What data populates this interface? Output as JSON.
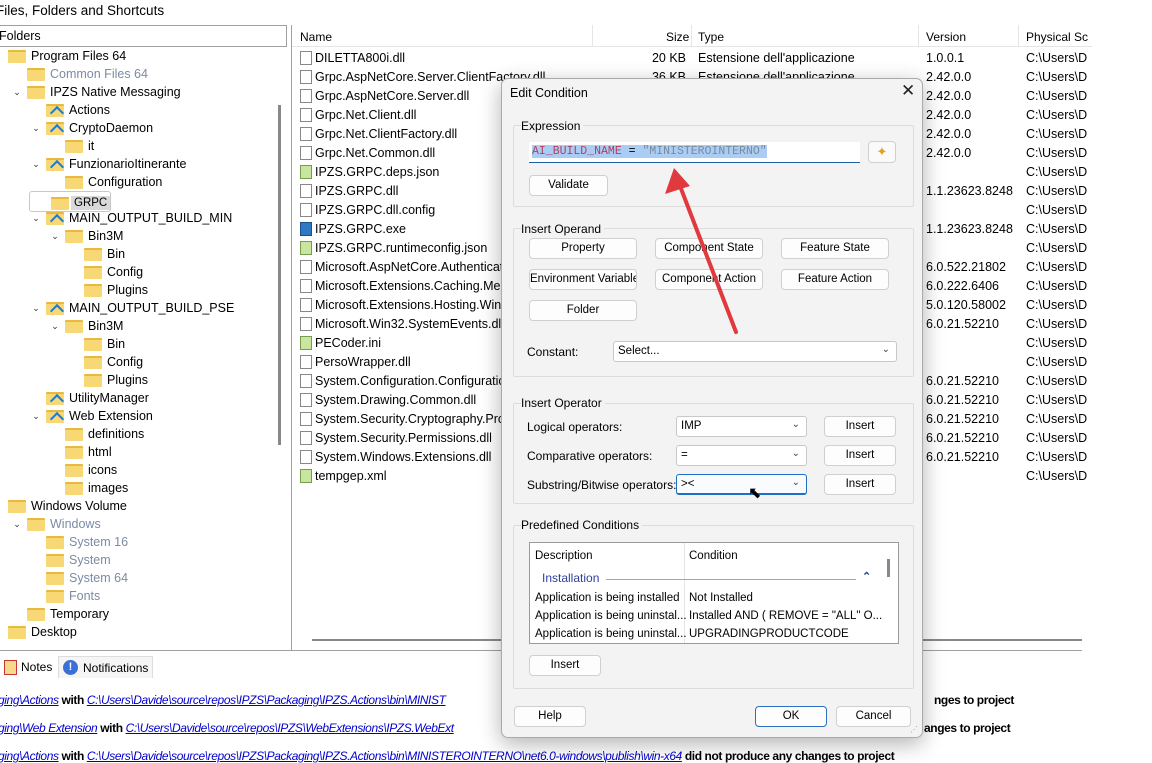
{
  "panel_title": "Files, Folders and Shortcuts",
  "tree_header": "Folders",
  "tree": [
    {
      "label": "Program Files 64",
      "level": 0,
      "chevron": true,
      "type": "folder"
    },
    {
      "label": "Common Files 64",
      "level": 1,
      "chevron": false,
      "type": "folder",
      "grey": true
    },
    {
      "label": "IPZS Native Messaging",
      "level": 1,
      "chevron": true,
      "type": "folder"
    },
    {
      "label": "Actions",
      "level": 2,
      "chevron": false,
      "type": "special"
    },
    {
      "label": "CryptoDaemon",
      "level": 2,
      "chevron": true,
      "type": "special"
    },
    {
      "label": "it",
      "level": 3,
      "chevron": false,
      "type": "folder"
    },
    {
      "label": "FunzionarioItinerante",
      "level": 2,
      "chevron": true,
      "type": "special"
    },
    {
      "label": "Configuration",
      "level": 3,
      "chevron": false,
      "type": "folder"
    },
    {
      "label": "GRPC",
      "level": 2,
      "chevron": false,
      "type": "folder",
      "selected": true
    },
    {
      "label": "MAIN_OUTPUT_BUILD_MIN",
      "level": 2,
      "chevron": true,
      "type": "special"
    },
    {
      "label": "Bin3M",
      "level": 3,
      "chevron": true,
      "type": "folder"
    },
    {
      "label": "Bin",
      "level": 4,
      "chevron": false,
      "type": "folder"
    },
    {
      "label": "Config",
      "level": 4,
      "chevron": false,
      "type": "folder"
    },
    {
      "label": "Plugins",
      "level": 4,
      "chevron": false,
      "type": "folder"
    },
    {
      "label": "MAIN_OUTPUT_BUILD_PSE",
      "level": 2,
      "chevron": true,
      "type": "special"
    },
    {
      "label": "Bin3M",
      "level": 3,
      "chevron": true,
      "type": "folder"
    },
    {
      "label": "Bin",
      "level": 4,
      "chevron": false,
      "type": "folder"
    },
    {
      "label": "Config",
      "level": 4,
      "chevron": false,
      "type": "folder"
    },
    {
      "label": "Plugins",
      "level": 4,
      "chevron": false,
      "type": "folder"
    },
    {
      "label": "UtilityManager",
      "level": 2,
      "chevron": false,
      "type": "special"
    },
    {
      "label": "Web Extension",
      "level": 2,
      "chevron": true,
      "type": "special"
    },
    {
      "label": "definitions",
      "level": 3,
      "chevron": false,
      "type": "folder"
    },
    {
      "label": "html",
      "level": 3,
      "chevron": false,
      "type": "folder"
    },
    {
      "label": "icons",
      "level": 3,
      "chevron": false,
      "type": "folder"
    },
    {
      "label": "images",
      "level": 3,
      "chevron": false,
      "type": "folder"
    },
    {
      "label": "Windows Volume",
      "level": 0,
      "chevron": true,
      "type": "folder"
    },
    {
      "label": "Windows",
      "level": 1,
      "chevron": true,
      "type": "folder",
      "grey": true
    },
    {
      "label": "System 16",
      "level": 2,
      "chevron": false,
      "type": "folder",
      "grey": true
    },
    {
      "label": "System",
      "level": 2,
      "chevron": false,
      "type": "folder",
      "grey": true
    },
    {
      "label": "System 64",
      "level": 2,
      "chevron": false,
      "type": "folder",
      "grey": true
    },
    {
      "label": "Fonts",
      "level": 2,
      "chevron": false,
      "type": "folder",
      "grey": true
    },
    {
      "label": "Temporary",
      "level": 1,
      "chevron": false,
      "type": "folder"
    },
    {
      "label": "Desktop",
      "level": 0,
      "chevron": false,
      "type": "folder"
    }
  ],
  "list_columns": {
    "name": "Name",
    "size": "Size",
    "type": "Type",
    "version": "Version",
    "physical": "Physical Sc"
  },
  "files": [
    {
      "name": "DILETTA800i.dll",
      "icon": "dll",
      "size": "20 KB",
      "type": "Estensione dell'applicazione",
      "version": "1.0.0.1",
      "physical": "C:\\Users\\D"
    },
    {
      "name": "Grpc.AspNetCore.Server.ClientFactory.dll",
      "icon": "dll",
      "size": "36 KB",
      "type": "Estensione dell'applicazione",
      "version": "2.42.0.0",
      "physical": "C:\\Users\\D"
    },
    {
      "name": "Grpc.AspNetCore.Server.dll",
      "icon": "dll",
      "size": "",
      "type": "",
      "version": "2.42.0.0",
      "physical": "C:\\Users\\D"
    },
    {
      "name": "Grpc.Net.Client.dll",
      "icon": "dll",
      "size": "",
      "type": "",
      "version": "2.42.0.0",
      "physical": "C:\\Users\\D"
    },
    {
      "name": "Grpc.Net.ClientFactory.dll",
      "icon": "dll",
      "size": "",
      "type": "",
      "version": "2.42.0.0",
      "physical": "C:\\Users\\D"
    },
    {
      "name": "Grpc.Net.Common.dll",
      "icon": "dll",
      "size": "",
      "type": "",
      "version": "2.42.0.0",
      "physical": "C:\\Users\\D"
    },
    {
      "name": "IPZS.GRPC.deps.json",
      "icon": "json",
      "size": "",
      "type": "",
      "version": "",
      "physical": "C:\\Users\\D"
    },
    {
      "name": "IPZS.GRPC.dll",
      "icon": "dll",
      "size": "",
      "type": "",
      "version": "1.1.23623.8248",
      "physical": "C:\\Users\\D"
    },
    {
      "name": "IPZS.GRPC.dll.config",
      "icon": "config",
      "size": "",
      "type": "",
      "version": "",
      "physical": "C:\\Users\\D"
    },
    {
      "name": "IPZS.GRPC.exe",
      "icon": "exe",
      "size": "",
      "type": "",
      "version": "1.1.23623.8248",
      "physical": "C:\\Users\\D"
    },
    {
      "name": "IPZS.GRPC.runtimeconfig.json",
      "icon": "json",
      "size": "",
      "type": "",
      "version": "",
      "physical": "C:\\Users\\D"
    },
    {
      "name": "Microsoft.AspNetCore.Authenticati",
      "icon": "dll",
      "size": "",
      "type": "",
      "version": "6.0.522.21802",
      "physical": "C:\\Users\\D"
    },
    {
      "name": "Microsoft.Extensions.Caching.Mem",
      "icon": "dll",
      "size": "",
      "type": "",
      "version": "6.0.222.6406",
      "physical": "C:\\Users\\D"
    },
    {
      "name": "Microsoft.Extensions.Hosting.Wind",
      "icon": "dll",
      "size": "",
      "type": "",
      "version": "5.0.120.58002",
      "physical": "C:\\Users\\D"
    },
    {
      "name": "Microsoft.Win32.SystemEvents.dll",
      "icon": "dll",
      "size": "",
      "type": "",
      "version": "6.0.21.52210",
      "physical": "C:\\Users\\D"
    },
    {
      "name": "PECoder.ini",
      "icon": "ini",
      "size": "",
      "type": "",
      "version": "",
      "physical": "C:\\Users\\D"
    },
    {
      "name": "PersoWrapper.dll",
      "icon": "dll",
      "size": "",
      "type": "",
      "version": "",
      "physical": "C:\\Users\\D"
    },
    {
      "name": "System.Configuration.Configuratio",
      "icon": "dll",
      "size": "",
      "type": "",
      "version": "6.0.21.52210",
      "physical": "C:\\Users\\D"
    },
    {
      "name": "System.Drawing.Common.dll",
      "icon": "dll",
      "size": "",
      "type": "",
      "version": "6.0.21.52210",
      "physical": "C:\\Users\\D"
    },
    {
      "name": "System.Security.Cryptography.Prote",
      "icon": "dll",
      "size": "",
      "type": "",
      "version": "6.0.21.52210",
      "physical": "C:\\Users\\D"
    },
    {
      "name": "System.Security.Permissions.dll",
      "icon": "dll",
      "size": "",
      "type": "",
      "version": "6.0.21.52210",
      "physical": "C:\\Users\\D"
    },
    {
      "name": "System.Windows.Extensions.dll",
      "icon": "dll",
      "size": "",
      "type": "",
      "version": "6.0.21.52210",
      "physical": "C:\\Users\\D"
    },
    {
      "name": "tempgep.xml",
      "icon": "xml",
      "size": "",
      "type": "",
      "version": "",
      "physical": "C:\\Users\\D"
    }
  ],
  "bottom_tabs": {
    "notes": "Notes",
    "notifications": "Notifications"
  },
  "log": [
    {
      "prefix": "ging\\Actions",
      "with": " with ",
      "path": "C:\\Users\\Davide\\source\\repos\\IPZS\\Packaging\\IPZS.Actions\\bin\\MINIST",
      "tail": "nges to project"
    },
    {
      "prefix": "ging\\Web Extension",
      "with": " with ",
      "path": "C:\\Users\\Davide\\source\\repos\\IPZS\\WebExtensions\\IPZS.WebExt",
      "tail": "anges to project"
    },
    {
      "prefix": "ging\\Actions",
      "with": " with ",
      "path": "C:\\Users\\Davide\\source\\repos\\IPZS\\Packaging\\IPZS.Actions\\bin\\MINISTEROINTERNO\\net6.0-windows\\publish\\win-x64",
      "tail": " did not produce any changes to project"
    }
  ],
  "dialog": {
    "title": "Edit Condition",
    "expression_group": "Expression",
    "expression": {
      "property": "AI_BUILD_NAME",
      "op": " = ",
      "value": "\"MINISTEROINTERNO\""
    },
    "validate": "Validate",
    "operand_group": "Insert Operand",
    "operands": [
      "Property",
      "Component State",
      "Feature State",
      "Environment Variable",
      "Component Action",
      "Feature Action",
      "Folder"
    ],
    "constant_label": "Constant:",
    "constant_value": "Select...",
    "operator_group": "Insert Operator",
    "operators": [
      {
        "label": "Logical operators:",
        "value": "IMP",
        "insert": "Insert"
      },
      {
        "label": "Comparative operators:",
        "value": "=",
        "insert": "Insert"
      },
      {
        "label": "Substring/Bitwise operators:",
        "value": "><",
        "insert": "Insert"
      }
    ],
    "predefined_group": "Predefined Conditions",
    "predefined_columns": {
      "description": "Description",
      "condition": "Condition"
    },
    "predefined_category": "Installation",
    "predefined_rows": [
      {
        "description": "Application is being installed",
        "condition": "Not Installed"
      },
      {
        "description": "Application is being uninstal...",
        "condition": "Installed AND ( REMOVE = \"ALL\" O..."
      },
      {
        "description": "Application is being uninstal...",
        "condition": "UPGRADINGPRODUCTCODE"
      }
    ],
    "predefined_insert": "Insert",
    "help": "Help",
    "ok": "OK",
    "cancel": "Cancel"
  },
  "colors": {
    "accent": "#1f6fc8",
    "selection": "#aacdf5",
    "annotation_arrow": "#e0393e",
    "link": "#0000cc"
  }
}
